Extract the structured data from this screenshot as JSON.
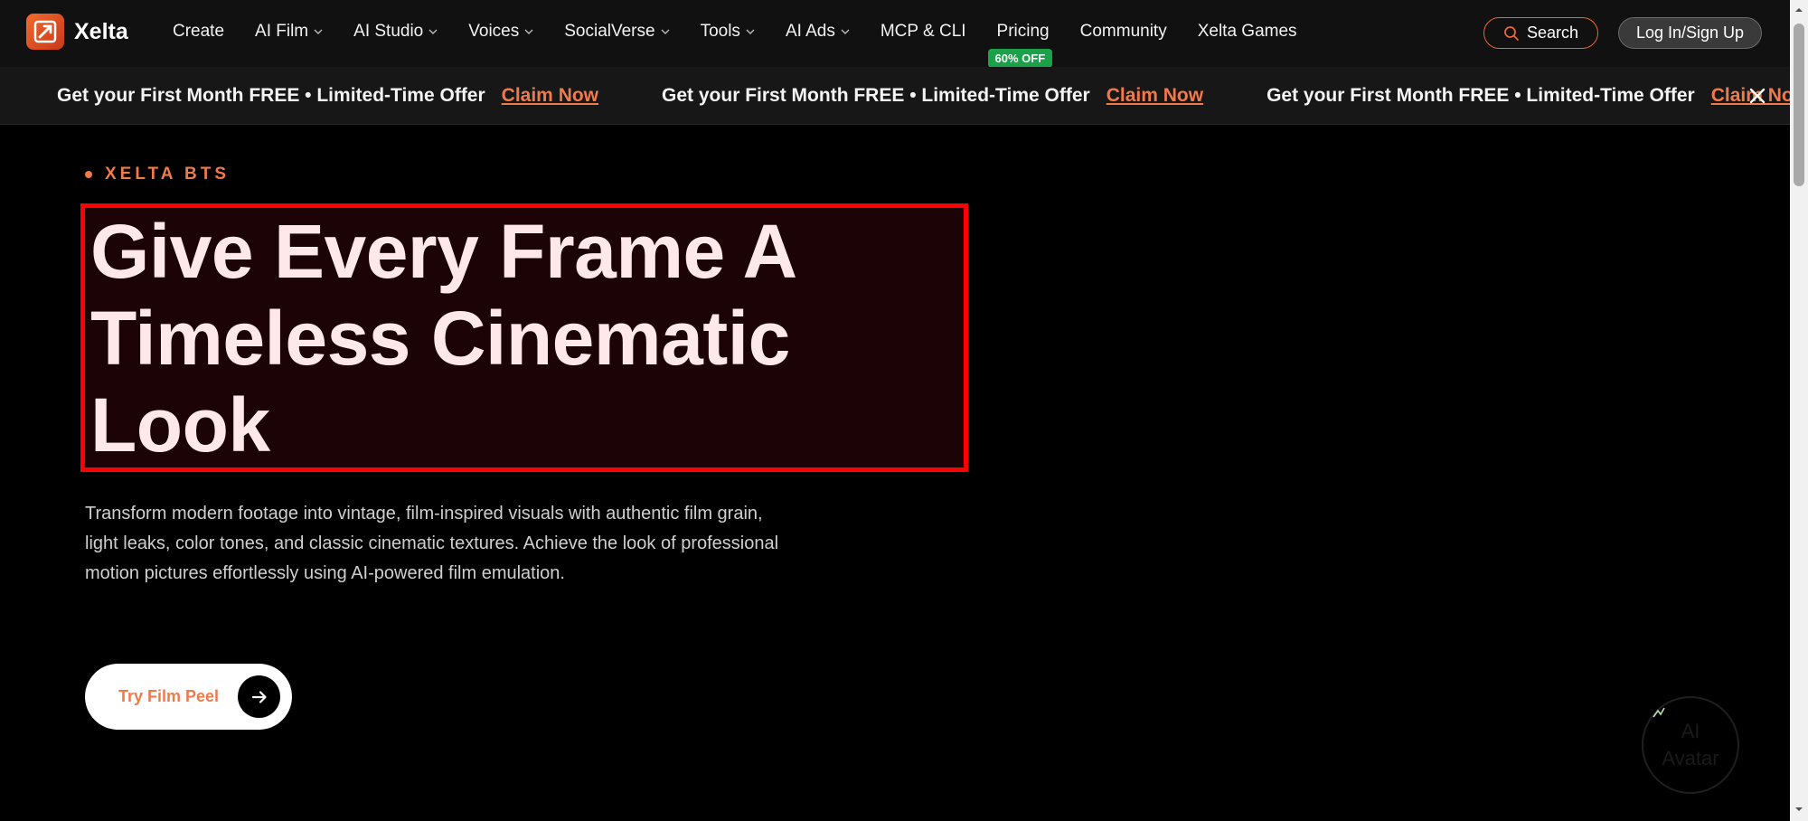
{
  "brand": {
    "name": "Xelta",
    "logo_icon": "xelta-logo-icon"
  },
  "nav": {
    "items": [
      {
        "label": "Create",
        "has_dropdown": false
      },
      {
        "label": "AI Film",
        "has_dropdown": true
      },
      {
        "label": "AI Studio",
        "has_dropdown": true
      },
      {
        "label": "Voices",
        "has_dropdown": true
      },
      {
        "label": "SocialVerse",
        "has_dropdown": true
      },
      {
        "label": "Tools",
        "has_dropdown": true
      },
      {
        "label": "AI Ads",
        "has_dropdown": true
      },
      {
        "label": "MCP & CLI",
        "has_dropdown": false
      },
      {
        "label": "Pricing",
        "has_dropdown": false,
        "badge": "60% OFF"
      },
      {
        "label": "Community",
        "has_dropdown": false
      },
      {
        "label": "Xelta Games",
        "has_dropdown": false
      }
    ],
    "search_label": "Search",
    "login_label": "Log In/Sign Up"
  },
  "promo": {
    "text": "Get your First Month FREE • Limited-Time Offer",
    "claim_label": "Claim Now",
    "close_icon": "close-icon"
  },
  "hero": {
    "eyebrow": "XELTA BTS",
    "headline_lines": [
      "Give Every Frame A",
      "Timeless Cinematic",
      "Look"
    ],
    "description": "Transform modern footage into vintage, film-inspired visuals with authentic film grain, light leaks, color tones, and classic cinematic textures. Achieve the look of professional motion pictures effortlessly using AI-powered film emulation.",
    "cta_label": "Try Film Peel"
  },
  "avatar": {
    "alt_text_line1": "AI",
    "alt_text_line2": "Avatar"
  },
  "colors": {
    "accent": "#f07a4a",
    "badge_green": "#1aa14a",
    "highlight_border": "#ff0000"
  }
}
